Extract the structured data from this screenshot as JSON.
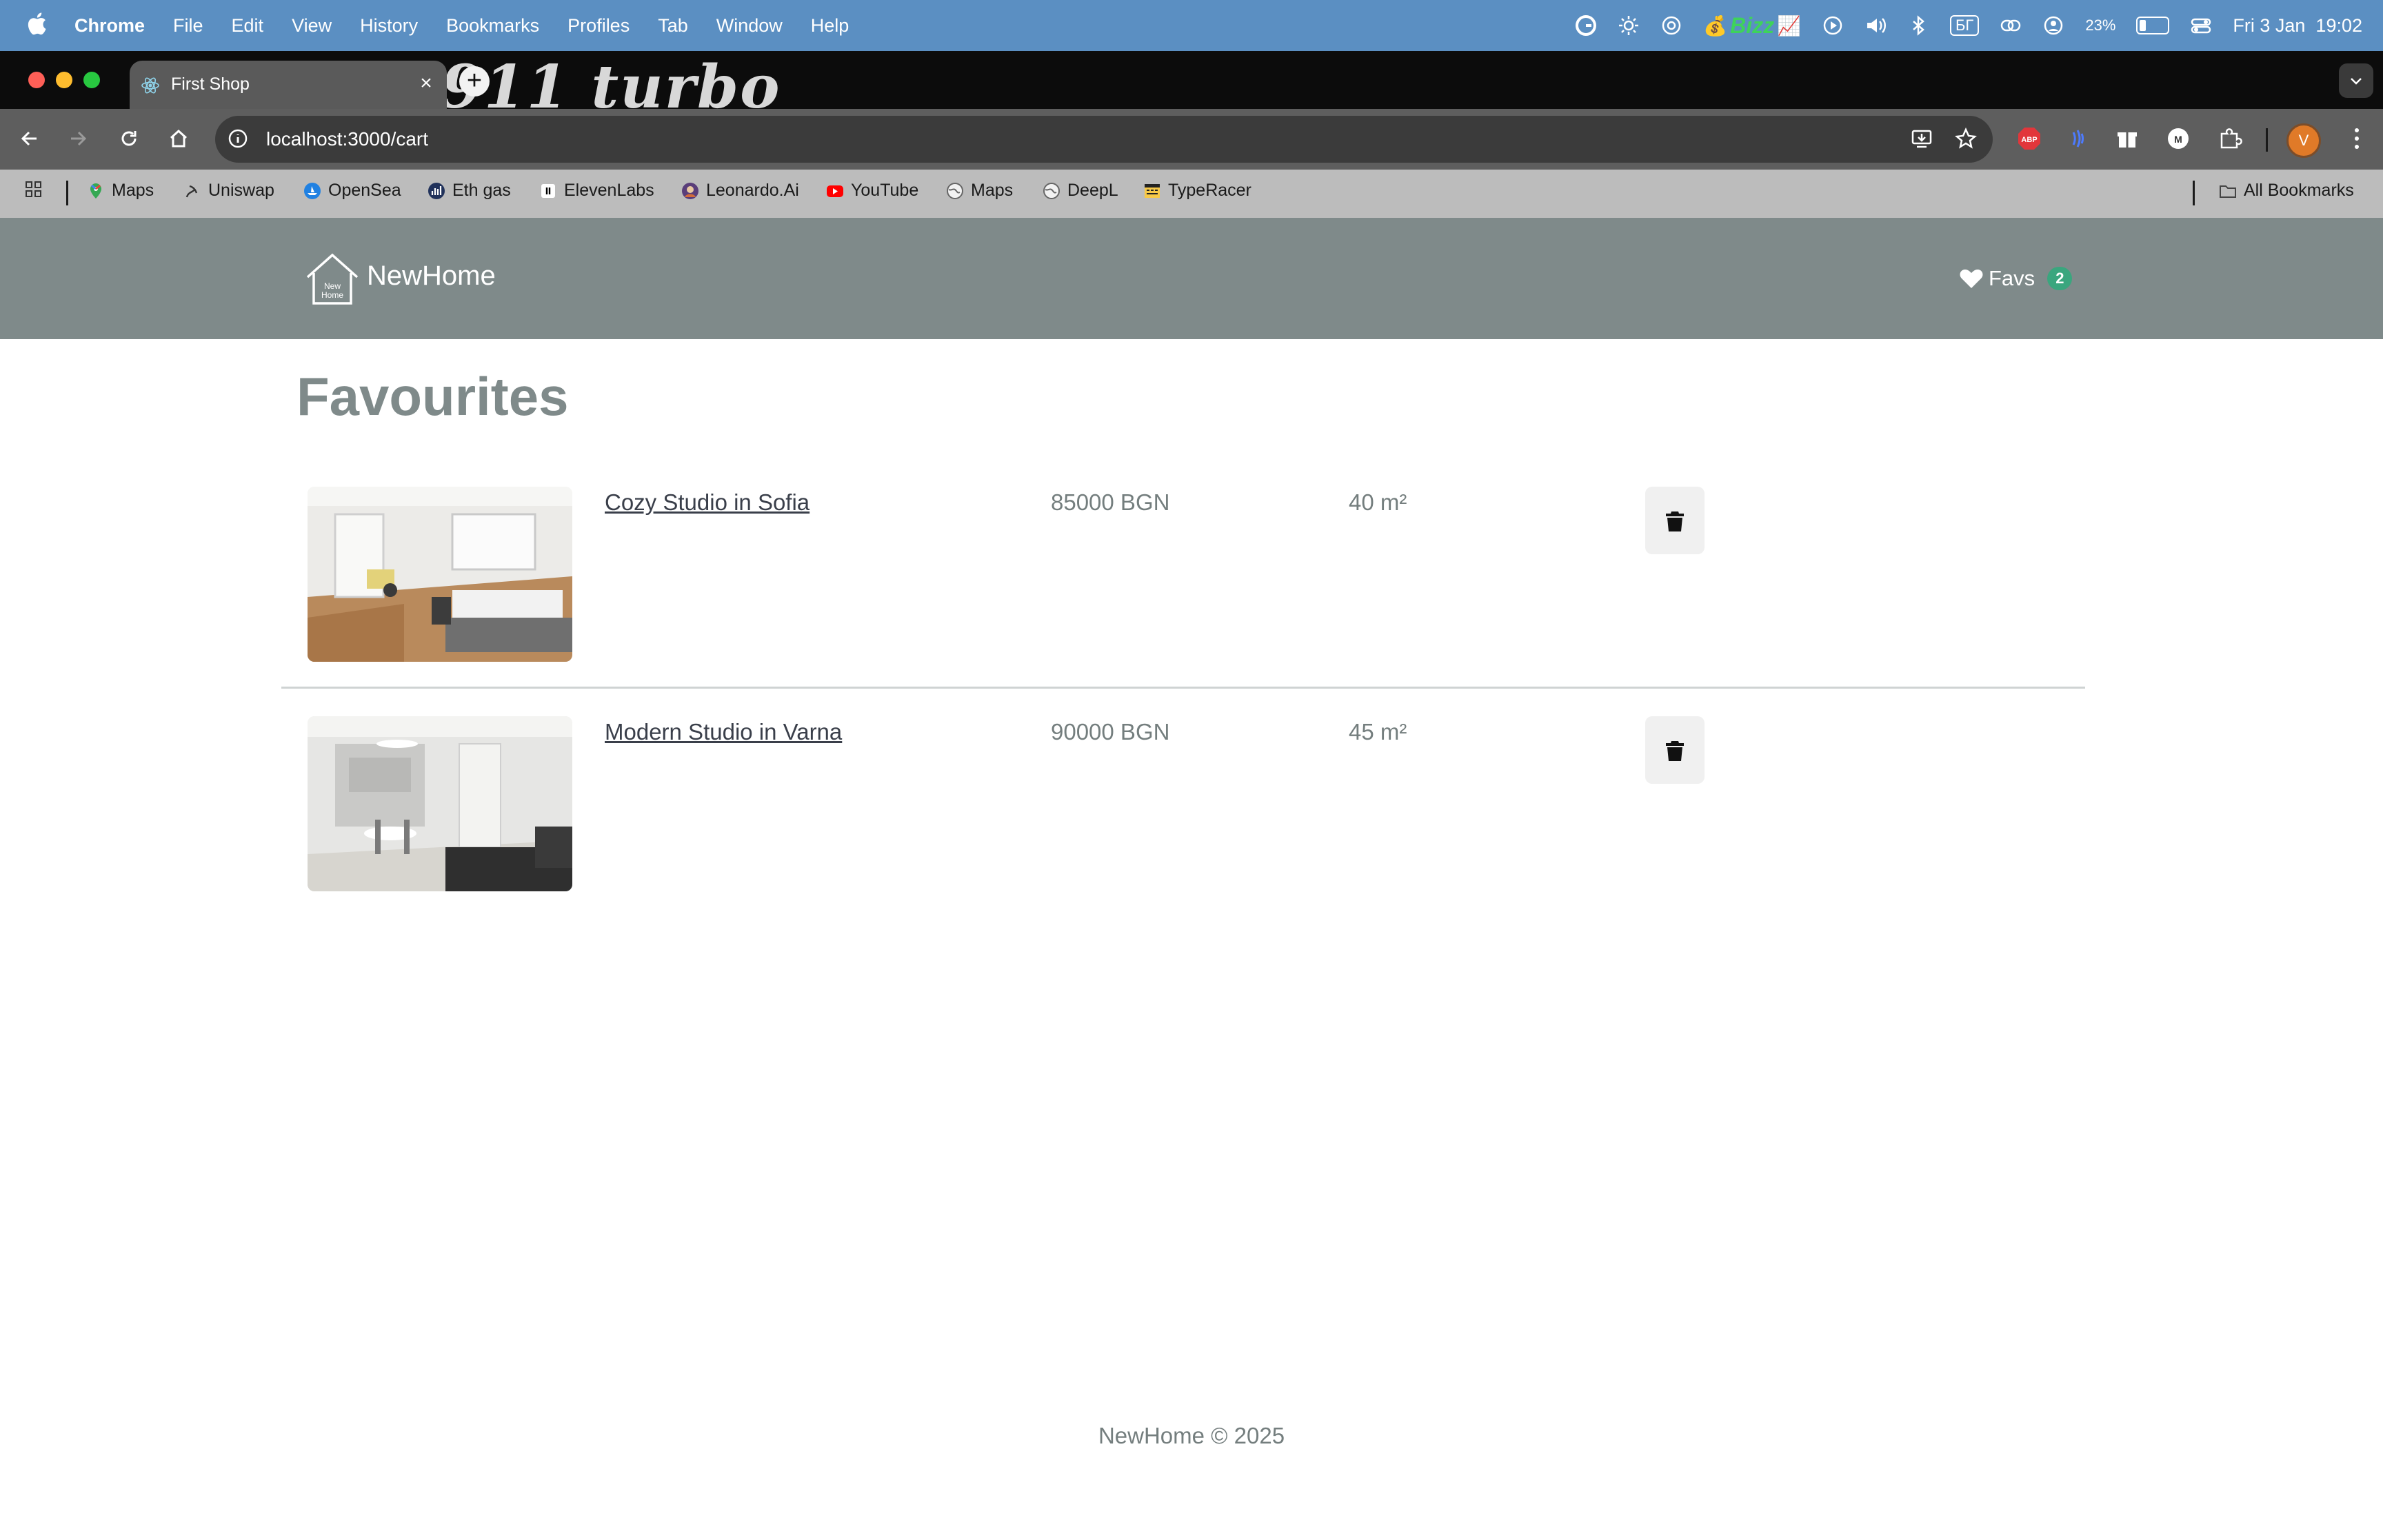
{
  "menubar": {
    "app_name": "Chrome",
    "items": [
      "File",
      "Edit",
      "View",
      "History",
      "Bookmarks",
      "Profiles",
      "Tab",
      "Window",
      "Help"
    ],
    "status": {
      "bizz_label": "Bizz",
      "keyboard_layout": "БГ",
      "battery_percent": "23%",
      "battery_level": 0.23,
      "datetime": "Fri 3 Jan  19:02"
    }
  },
  "browser": {
    "tab_title": "First Shop",
    "tab_close": "×",
    "new_tab": "+",
    "wallpaper_text": "911 turbo",
    "url": "localhost:3000/cart",
    "profile_initial": "V",
    "bookmarks": [
      {
        "label": "Maps",
        "icon": "google-maps-icon"
      },
      {
        "label": "Uniswap",
        "icon": "uniswap-icon"
      },
      {
        "label": "OpenSea",
        "icon": "opensea-icon"
      },
      {
        "label": "Eth gas",
        "icon": "etherscan-icon"
      },
      {
        "label": "ElevenLabs",
        "icon": "elevenlabs-icon"
      },
      {
        "label": "Leonardo.Ai",
        "icon": "leonardo-icon"
      },
      {
        "label": "YouTube",
        "icon": "youtube-icon"
      },
      {
        "label": "Maps",
        "icon": "globe-icon"
      },
      {
        "label": "DeepL",
        "icon": "globe-icon"
      },
      {
        "label": "TypeRacer",
        "icon": "typeracer-icon"
      }
    ],
    "all_bookmarks": "All Bookmarks"
  },
  "site": {
    "brand": "NewHome",
    "logo_text_top": "New",
    "logo_text_bottom": "Home",
    "favs_label": "Favs",
    "favs_count": "2",
    "page_title": "Favourites",
    "items": [
      {
        "title": "Cozy Studio in Sofia",
        "price": "85000 BGN",
        "area": "40 m²"
      },
      {
        "title": "Modern Studio in Varna",
        "price": "90000 BGN",
        "area": "45 m²"
      }
    ],
    "footer": "NewHome © 2025"
  },
  "colors": {
    "header_bg": "#7f8a8a",
    "badge": "#3aa67e",
    "menubar": "#5b8fc2"
  }
}
